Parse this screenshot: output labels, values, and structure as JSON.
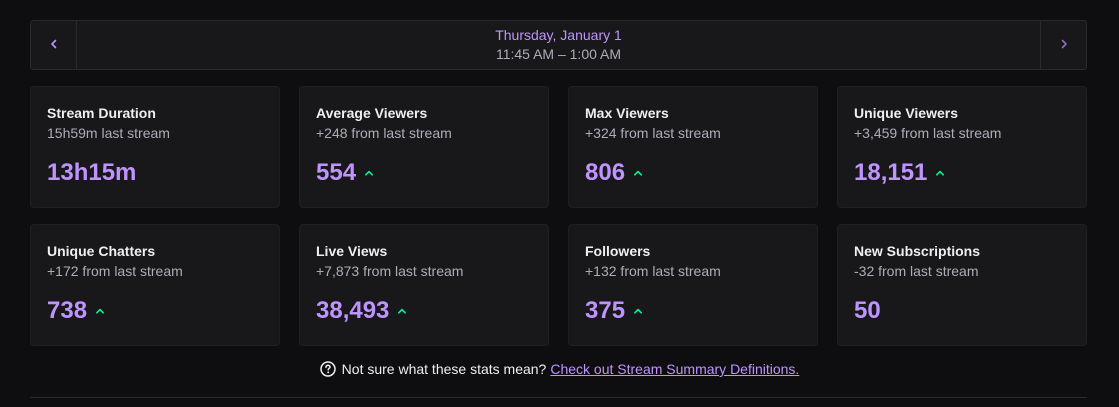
{
  "date_nav": {
    "date": "Thursday, January 1",
    "time_range": "11:45 AM – 1:00 AM",
    "prev_icon": "chevron-left-icon",
    "next_icon": "chevron-right-icon"
  },
  "colors": {
    "accent": "#bf94ff",
    "positive": "#00f593",
    "background": "#0e0e10",
    "card": "#18181b"
  },
  "stats": [
    {
      "title": "Stream Duration",
      "subtitle": "15h59m last stream",
      "value": "13h15m",
      "trend": "none"
    },
    {
      "title": "Average Viewers",
      "subtitle": "+248 from last stream",
      "value": "554",
      "trend": "up"
    },
    {
      "title": "Max Viewers",
      "subtitle": "+324 from last stream",
      "value": "806",
      "trend": "up"
    },
    {
      "title": "Unique Viewers",
      "subtitle": "+3,459 from last stream",
      "value": "18,151",
      "trend": "up"
    },
    {
      "title": "Unique Chatters",
      "subtitle": "+172 from last stream",
      "value": "738",
      "trend": "up"
    },
    {
      "title": "Live Views",
      "subtitle": "+7,873 from last stream",
      "value": "38,493",
      "trend": "up"
    },
    {
      "title": "Followers",
      "subtitle": "+132 from last stream",
      "value": "375",
      "trend": "up"
    },
    {
      "title": "New Subscriptions",
      "subtitle": "-32 from last stream",
      "value": "50",
      "trend": "none"
    }
  ],
  "help": {
    "icon": "question-circle-icon",
    "text": "Not sure what these stats mean?",
    "link_text": "Check out Stream Summary Definitions."
  }
}
